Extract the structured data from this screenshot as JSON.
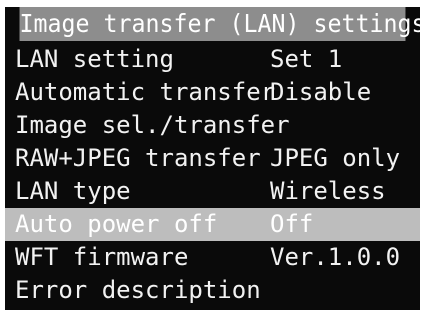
{
  "title": "Image transfer (LAN) settings",
  "menu": {
    "items": [
      {
        "label": "LAN setting",
        "value": "Set 1"
      },
      {
        "label": "Automatic transfer",
        "value": "Disable"
      },
      {
        "label": "Image sel./transfer",
        "value": ""
      },
      {
        "label": "RAW+JPEG transfer",
        "value": "JPEG only"
      },
      {
        "label": "LAN type",
        "value": "Wireless"
      },
      {
        "label": "Auto power off",
        "value": "Off",
        "selected": true
      },
      {
        "label": "WFT firmware",
        "value": "Ver.1.0.0"
      },
      {
        "label": "Error description",
        "value": ""
      }
    ]
  },
  "colors": {
    "screen_bg": "#0a0a0a",
    "title_bar": "#8d8d8d",
    "selected_row": "#bdbdbd",
    "text": "#f2f2f2"
  }
}
